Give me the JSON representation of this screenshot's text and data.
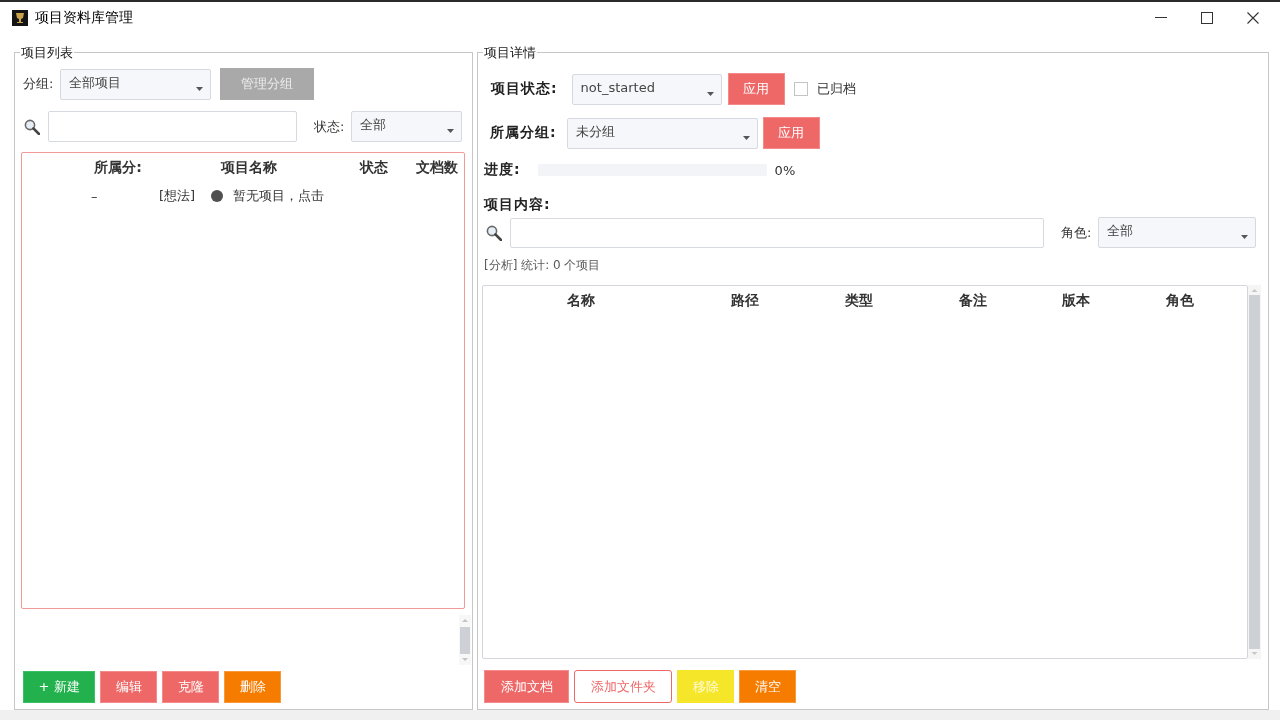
{
  "window": {
    "title": "项目资料库管理"
  },
  "project_list": {
    "title": "项目列表",
    "group_filter": {
      "label": "分组:",
      "value": "全部项目"
    },
    "manage_groups_button": {
      "label": "管理分组",
      "disabled": true
    },
    "status_filter": {
      "label": "状态:",
      "value": "全部"
    },
    "table": {
      "columns": [
        "所属分:",
        "项目名称",
        "状态",
        "文档数"
      ],
      "rows": [
        {
          "group": "–",
          "tag": "[想法]",
          "color": "#505050",
          "name": "暂无项目，点击"
        }
      ]
    },
    "buttons": [
      {
        "label": "+ 新建",
        "kind": "success"
      },
      {
        "label": "编辑",
        "kind": "danger"
      },
      {
        "label": "克隆",
        "kind": "danger"
      },
      {
        "label": "删除",
        "kind": "warning"
      }
    ]
  },
  "project_details": {
    "title": "项目详情",
    "status": {
      "label": "项目状态:",
      "value": "not_started",
      "apply_button": "应用"
    },
    "archived": {
      "label": "已归档",
      "checked": false
    },
    "group": {
      "label": "所属分组:",
      "value": "未分组",
      "apply_button": "应用"
    },
    "progress": {
      "label": "进度:",
      "level": 0,
      "reading": "0%"
    },
    "content": {
      "label": "项目内容:",
      "role_filter": {
        "label": "角色:",
        "value": "全部"
      },
      "summary": "[分析] 统计: 0 个项目",
      "table": {
        "columns": [
          "名称",
          "路径",
          "类型",
          "备注",
          "版本",
          "角色"
        ]
      },
      "buttons": [
        {
          "label": "添加文档",
          "kind": "danger"
        },
        {
          "label": "添加文件夹",
          "kind": "outline"
        },
        {
          "label": "移除",
          "kind": "caution"
        },
        {
          "label": "清空",
          "kind": "warning"
        }
      ]
    }
  }
}
